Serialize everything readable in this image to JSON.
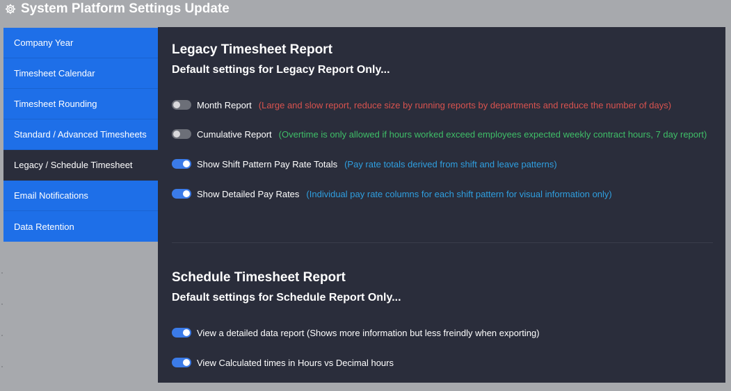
{
  "app": {
    "title": "System Platform Settings Update"
  },
  "sidebar": {
    "items": [
      {
        "label": "Company Year"
      },
      {
        "label": "Timesheet Calendar"
      },
      {
        "label": "Timesheet Rounding"
      },
      {
        "label": "Standard / Advanced Timesheets"
      },
      {
        "label": "Legacy / Schedule Timesheet"
      },
      {
        "label": "Email Notifications"
      },
      {
        "label": "Data Retention"
      }
    ],
    "active": "Legacy / Schedule Timesheet"
  },
  "legacy": {
    "title": "Legacy Timesheet Report",
    "subtitle": "Default settings for Legacy Report Only...",
    "settings": [
      {
        "label": "Month Report",
        "enabled": false,
        "note": "(Large and slow report, reduce size by running reports by departments and reduce the number of days)",
        "note_color": "#d9534f"
      },
      {
        "label": "Cumulative Report",
        "enabled": false,
        "note": "(Overtime is only allowed if hours worked exceed employees expected weekly contract hours, 7 day report)",
        "note_color": "#3fbf68"
      },
      {
        "label": "Show Shift Pattern Pay Rate Totals",
        "enabled": true,
        "note": "(Pay rate totals derived from shift and leave patterns)",
        "note_color": "#2f9fe0"
      },
      {
        "label": "Show Detailed Pay Rates",
        "enabled": true,
        "note": "(Individual pay rate columns for each shift pattern for visual information only)",
        "note_color": "#2f9fe0"
      }
    ]
  },
  "schedule": {
    "title": "Schedule Timesheet Report",
    "subtitle": "Default settings for Schedule Report Only...",
    "settings": [
      {
        "label": "View a detailed data report (Shows more information but less freindly when exporting)",
        "enabled": true
      },
      {
        "label": "View Calculated times in Hours vs Decimal hours",
        "enabled": true
      }
    ]
  },
  "colors": {
    "accent": "#1e6fe8",
    "panel": "#2a2d3b",
    "toggle_on": "#3b7be8",
    "toggle_off": "#6c6f78"
  },
  "icons": {
    "title_icon": "gear-icon"
  }
}
